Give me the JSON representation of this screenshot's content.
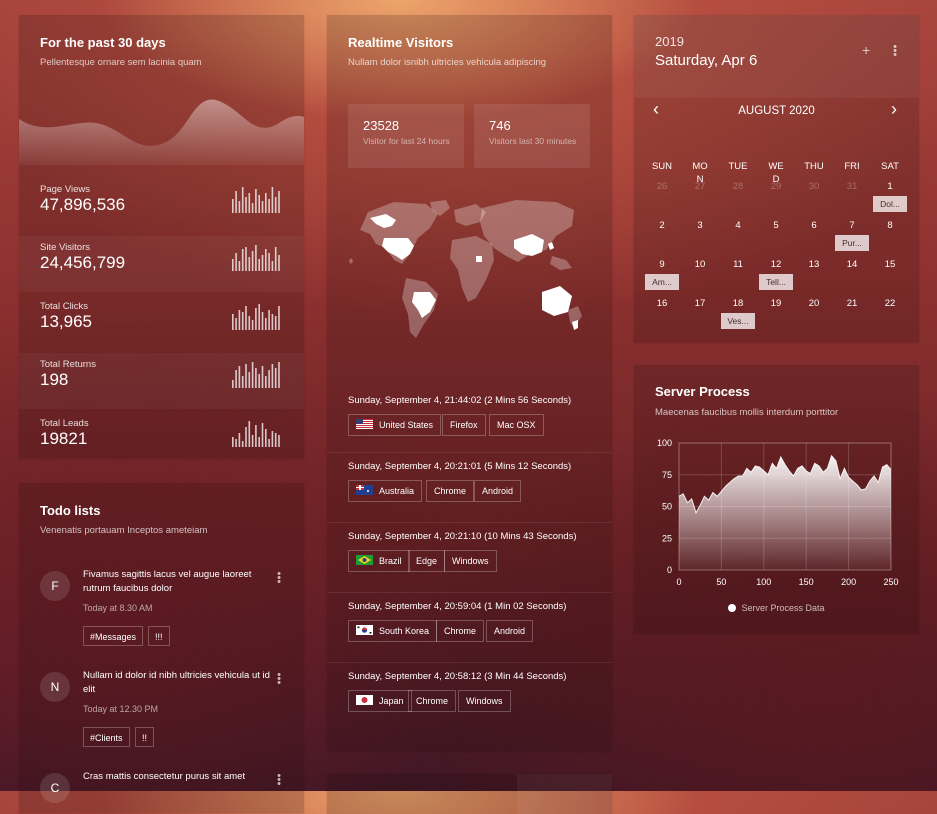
{
  "stats_card": {
    "title": "For the past 30 days",
    "subtitle": "Pellentesque ornare sem lacinia quam",
    "items": [
      {
        "label": "Page Views",
        "value": "47,896,536"
      },
      {
        "label": "Site Visitors",
        "value": "24,456,799"
      },
      {
        "label": "Total Clicks",
        "value": "13,965"
      },
      {
        "label": "Total Returns",
        "value": "198"
      },
      {
        "label": "Total Leads",
        "value": "19821"
      }
    ]
  },
  "todo_card": {
    "title": "Todo lists",
    "subtitle": "Venenatis portauam Inceptos ameteiam",
    "items": [
      {
        "initial": "F",
        "text": "Fivamus sagittis lacus vel augue laoreet rutrum faucibus dolor",
        "time": "Today at 8.30 AM",
        "tags": [
          "#Messages",
          "!!!"
        ]
      },
      {
        "initial": "N",
        "text": "Nullam id dolor id nibh ultricies vehicula ut id elit",
        "time": "Today at 12.30 PM",
        "tags": [
          "#Clients",
          "!!"
        ]
      },
      {
        "initial": "C",
        "text": "Cras mattis consectetur purus sit amet"
      }
    ]
  },
  "realtime_card": {
    "title": "Realtime Visitors",
    "subtitle": "Nullam dolor isnibh ultricies vehicula adipiscing",
    "stat1": {
      "value": "23528",
      "caption": "Visitor for last 24 hours"
    },
    "stat2": {
      "value": "746",
      "caption": "Visitors last 30 minutes"
    },
    "visits": [
      {
        "datetime": "Sunday, September 4, 21:44:02 (2 Mins 56 Seconds)",
        "country": "United States",
        "browser": "Firefox",
        "os": "Mac OSX",
        "flag": "us-flag-icon"
      },
      {
        "datetime": "Sunday, September 4, 20:21:01 (5 Mins 12 Seconds)",
        "country": "Australia",
        "browser": "Chrome",
        "os": "Android",
        "flag": "au-flag-icon"
      },
      {
        "datetime": "Sunday, September 4, 20:21:10 (10 Mins 43 Seconds)",
        "country": "Brazil",
        "browser": "Edge",
        "os": "Windows",
        "flag": "br-flag-icon"
      },
      {
        "datetime": "Sunday, September 4, 20:59:04 (1 Min 02 Seconds)",
        "country": "South Korea",
        "browser": "Chrome",
        "os": "Android",
        "flag": "kr-flag-icon"
      },
      {
        "datetime": "Sunday, September 4, 20:58:12 (3 Min 44 Seconds)",
        "country": "Japan",
        "browser": "Chrome",
        "os": "Windows",
        "flag": "jp-flag-icon"
      }
    ]
  },
  "calendar_card": {
    "year": "2019",
    "date": "Saturday, Apr 6",
    "add_icon": "+",
    "menu_icon": "⋮",
    "month": "AUGUST 2020",
    "prev_icon": "‹",
    "next_icon": "›",
    "weekdays": [
      "SUN",
      "MO N",
      "TUE",
      "WE D",
      "THU",
      "FRI",
      "SAT"
    ],
    "weeks": [
      [
        "26",
        "27",
        "28",
        "29",
        "30",
        "31",
        "1"
      ],
      [
        "2",
        "3",
        "4",
        "5",
        "6",
        "7",
        "8"
      ],
      [
        "9",
        "10",
        "11",
        "12",
        "13",
        "14",
        "15"
      ],
      [
        "16",
        "17",
        "18",
        "19",
        "20",
        "21",
        "22"
      ]
    ],
    "muted_first_row_count": 6,
    "events": [
      {
        "label": "Dol...",
        "week": 0,
        "col": 6
      },
      {
        "label": "Pur...",
        "week": 1,
        "col": 5
      },
      {
        "label": "Am...",
        "week": 2,
        "col": 0
      },
      {
        "label": "Tell...",
        "week": 2,
        "col": 3
      },
      {
        "label": "Ves...",
        "week": 3,
        "col": 2
      }
    ]
  },
  "server_card": {
    "title": "Server Process",
    "subtitle": "Maecenas faucibus mollis interdum porttitor",
    "legend": "Server Process Data"
  },
  "chart_data": {
    "type": "area",
    "series": [
      {
        "name": "Server Process Data",
        "x": [
          0,
          5,
          10,
          15,
          20,
          25,
          30,
          35,
          40,
          45,
          50,
          55,
          60,
          65,
          70,
          75,
          80,
          85,
          90,
          95,
          100,
          105,
          110,
          115,
          120,
          125,
          130,
          135,
          140,
          145,
          150,
          155,
          160,
          165,
          170,
          175,
          180,
          185,
          190,
          195,
          200,
          205,
          210,
          215,
          220,
          225,
          230,
          235,
          240,
          245,
          250
        ],
        "values": [
          58,
          60,
          53,
          56,
          45,
          51,
          58,
          55,
          61,
          58,
          62,
          66,
          69,
          72,
          74,
          74,
          80,
          77,
          82,
          81,
          78,
          75,
          84,
          80,
          89,
          83,
          78,
          74,
          80,
          82,
          78,
          76,
          84,
          82,
          77,
          80,
          90,
          86,
          72,
          80,
          73,
          70,
          67,
          63,
          64,
          70,
          74,
          69,
          81,
          83,
          79
        ]
      }
    ],
    "xlim": [
      0,
      250
    ],
    "ylim": [
      0,
      100
    ],
    "xticks": [
      "0",
      "50",
      "100",
      "150",
      "200",
      "250"
    ],
    "yticks": [
      "0",
      "25",
      "50",
      "75",
      "100"
    ],
    "grid": true,
    "legend_position": "bottom-center"
  },
  "colors": {
    "accent": "#ffffff",
    "event_bg": "#efe6e6",
    "event_text": "#4a2a2a"
  },
  "icons": [
    "wave-chart-icon",
    "mini-bar-chart-icon",
    "world-map-icon",
    "kebab-menu-icon",
    "plus-icon",
    "chevron-left-icon",
    "chevron-right-icon"
  ]
}
